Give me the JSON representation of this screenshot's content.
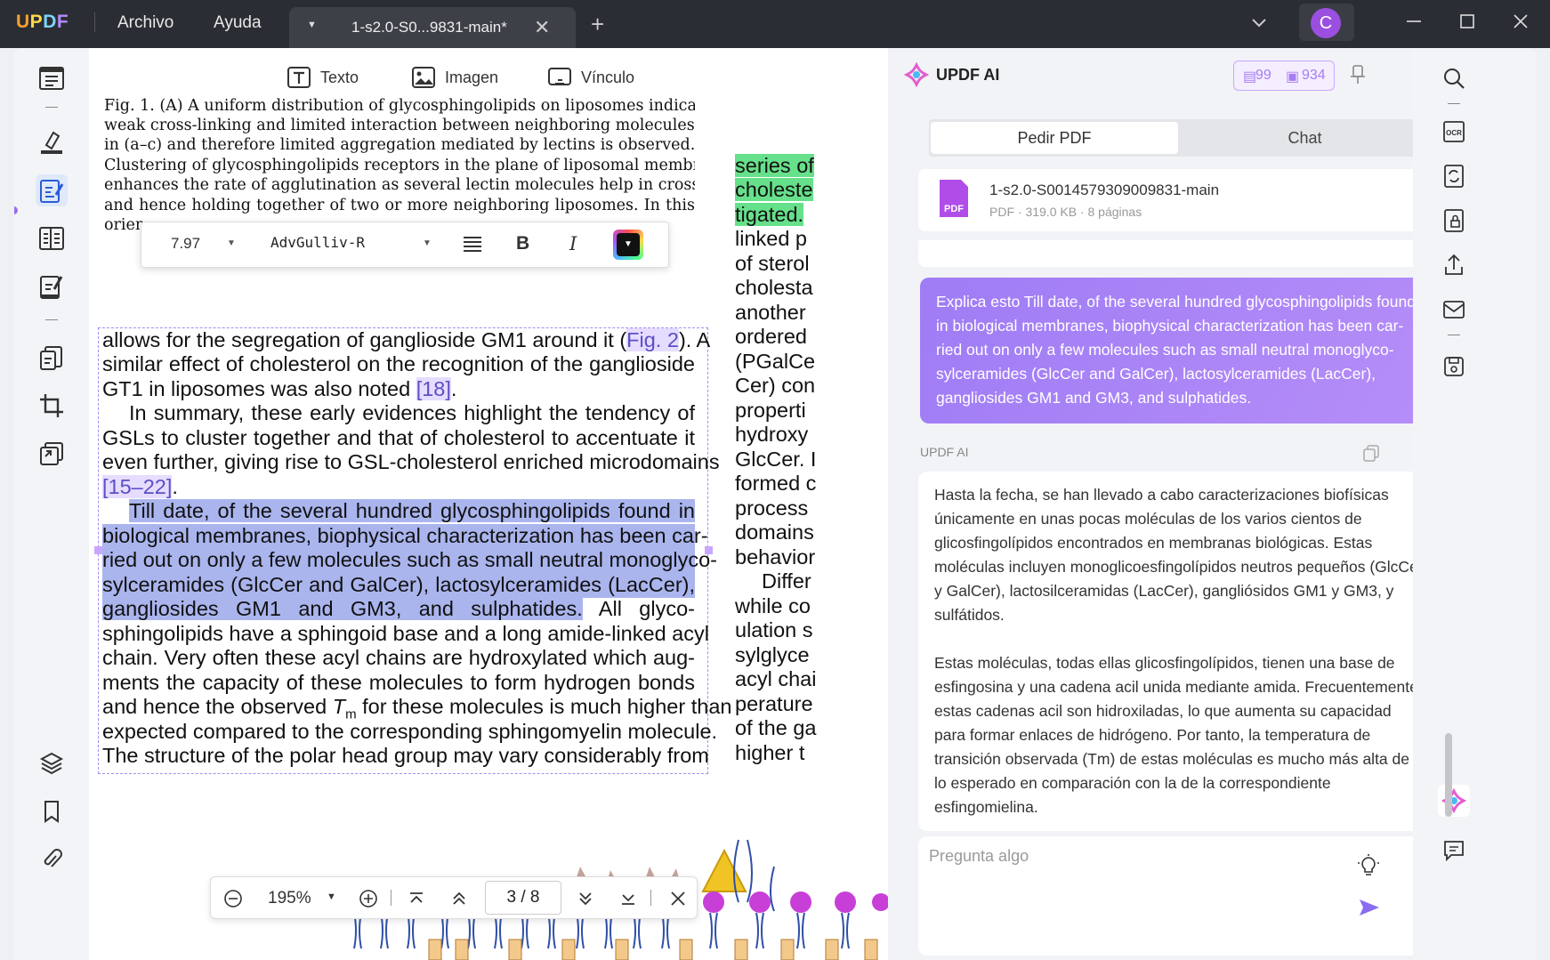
{
  "app": {
    "logo": "UPDF",
    "menu": [
      "Archivo",
      "Ayuda"
    ],
    "tab_title": "1-s2.0-S0...9831-main*",
    "avatar_letter": "C"
  },
  "colors": {
    "accent": "#9b6cf2",
    "text_highlight": "#aab5ee",
    "green_highlight": "#66e08a",
    "ref_link": "#5b4fc4"
  },
  "edit_toolbar": {
    "text": "Texto",
    "image": "Imagen",
    "link": "Vínculo"
  },
  "font_toolbar": {
    "size": "7.97",
    "font": "AdvGulliv-R",
    "bold": "B",
    "italic": "I"
  },
  "document": {
    "caption_lines": [
      "Fig. 1. (A) A uniform distribution of glycosphingolipids on liposomes indicates",
      "weak cross-linking and limited interaction between neighboring molecules as seen",
      "in (a–c) and therefore limited aggregation mediated by lectins is observed. (B)",
      "Clustering of glycosphingolipids receptors in the plane of liposomal membrane",
      "enhances the rate of agglutination as several lectin molecules help in cross-linking",
      "and hence holding together of two or more neighboring liposomes. In this",
      "orien"
    ],
    "line1": {
      "a": "allows for the segregation of ganglioside GM1 around it (",
      "ref": "Fig. 2",
      "b": "). A"
    },
    "line2": "similar effect of cholesterol on the recognition of the ganglioside",
    "line3": {
      "a": "GT1 in liposomes was also noted ",
      "ref": "[18]",
      "b": "."
    },
    "line4": "In summary, these early evidences highlight the tendency of",
    "line5": "GSLs to cluster together and that of cholesterol to accentuate it",
    "line6": "even further, giving rise to GSL-cholesterol enriched microdomains",
    "line7": {
      "ref": "[15–22]",
      "b": "."
    },
    "highlighted_lines": [
      "Till date, of the several hundred glycosphingolipids found in",
      "biological membranes, biophysical characterization has been car-",
      "ried out on only a few molecules such as small neutral monoglyco-",
      "sylceramides (GlcCer and GalCer), lactosylceramides (LacCer),",
      "gangliosides GM1 and GM3, and sulphatides."
    ],
    "line13_rest": " All glyco-",
    "after_lines": [
      "sphingolipids have a sphingoid base and a long amide-linked acyl",
      "chain. Very often these acyl chains are hydroxylated which aug-",
      "ments the capacity of these molecules to form hydrogen bonds"
    ],
    "line17": {
      "a": "and hence the observed ",
      "tm": "T",
      "sub": "m",
      "b": " for these molecules is much higher than"
    },
    "line18": "expected compared to the corresponding sphingomyelin molecule.",
    "line19": "The structure of the polar head group may vary considerably from",
    "right_column": [
      "series of",
      "choleste",
      "tigated.",
      "linked p",
      "of sterol",
      "cholesta",
      "another",
      "ordered",
      "(PGalCe",
      "Cer) con",
      "properti",
      "hydroxy",
      "GlcCer. I",
      "formed c",
      "process ",
      "domains",
      "behavior",
      "Differ",
      "while co",
      "ulation s",
      "sylglyce",
      "acyl chai",
      "perature",
      "of the ga",
      "higher t"
    ]
  },
  "zoom_bar": {
    "zoom": "195%",
    "page_current": "3",
    "page_sep": "/",
    "page_total": "8"
  },
  "ai_panel": {
    "title": "UPDF AI",
    "quota_docs": "99",
    "quota_msgs": "934",
    "tabs": [
      "Pedir PDF",
      "Chat"
    ],
    "file": {
      "name": "1-s2.0-S0014579309009831-main",
      "meta": "PDF · 319.0 KB · 8 páginas",
      "icon_label": "PDF"
    },
    "user_message": "Explica esto Till date, of the several hundred glycosphingolipids found in biological membranes, biophysical characterization has been car-ried out on only a few molecules such as small neutral monoglyco-sylceramides (GlcCer and GalCer), lactosylceramides (LacCer), gangliosides GM1 and GM3, and sulphatides.",
    "ai_label": "UPDF AI",
    "answer_p1": "Hasta la fecha, se han llevado a cabo caracterizaciones biofísicas únicamente en unas pocas moléculas de los varios cientos de glicosfingolípidos encontrados en membranas biológicas. Estas moléculas incluyen monoglicoesfingolípidos neutros pequeños (GlcCer y GalCer), lactosilceramidas (LacCer), gangliósidos GM1 y GM3, y sulfátidos.",
    "answer_p2": "Estas moléculas, todas ellas glicosfingolípidos, tienen una base de esfingosina y una cadena acil unida mediante amida. Frecuentemente, estas cadenas acil son hidroxiladas, lo que aumenta su capacidad para formar enlaces de hidrógeno. Por tanto, la temperatura de transición observada (Tm) de estas moléculas es mucho más alta de lo esperado en comparación con la de la correspondiente esfingomielina.",
    "input_placeholder": "Pregunta algo"
  },
  "icons": [
    "reader-icon",
    "comment-icon",
    "edit-pdf-icon",
    "organize-icon",
    "form-icon",
    "convert-icon",
    "crop-icon",
    "protect-icon",
    "layers-icon",
    "bookmark-icon",
    "attachment-icon",
    "search-icon",
    "ocr-icon",
    "convert-doc-icon",
    "protect-doc-icon",
    "share-icon",
    "email-icon",
    "save-icon",
    "updf-ai-icon",
    "chat-icon"
  ]
}
